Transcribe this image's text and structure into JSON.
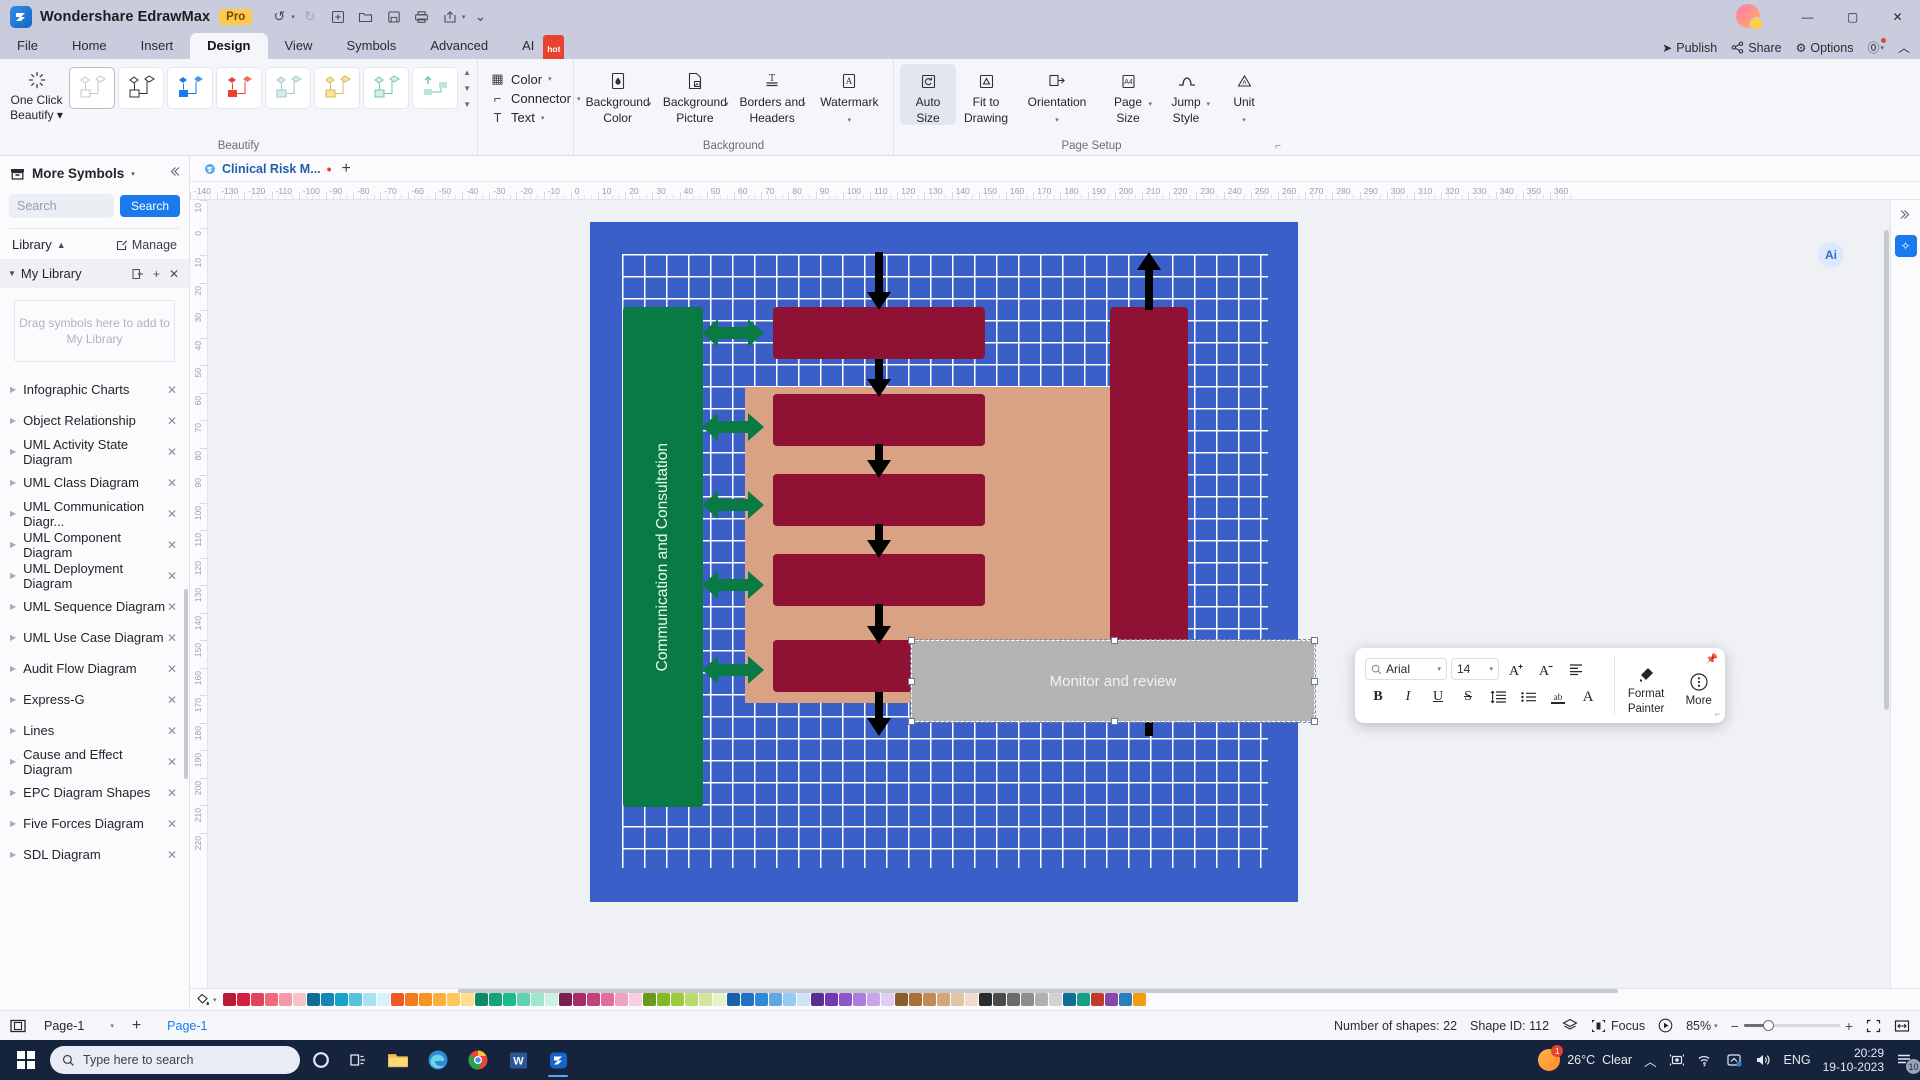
{
  "titlebar": {
    "app_name": "Wondershare EdrawMax",
    "pro_badge": "Pro",
    "logo_icon": "edraw-logo-icon",
    "quick_access": [
      {
        "name": "undo-icon",
        "glyph": "↺",
        "dim": false,
        "caret": true
      },
      {
        "name": "redo-icon",
        "glyph": "↻",
        "dim": true,
        "caret": false
      },
      {
        "name": "new-icon",
        "glyph": "⊞",
        "dim": false,
        "caret": false
      },
      {
        "name": "open-icon",
        "glyph": "🗁",
        "dim": false,
        "caret": false
      },
      {
        "name": "save-icon",
        "glyph": "🖫",
        "dim": false,
        "caret": false
      },
      {
        "name": "print-icon",
        "glyph": "🖨",
        "dim": false,
        "caret": false
      },
      {
        "name": "export-icon",
        "glyph": "🡕",
        "dim": false,
        "caret": true
      },
      {
        "name": "customize-qat-icon",
        "glyph": "⌄",
        "dim": false,
        "caret": false
      }
    ],
    "window_controls": [
      {
        "name": "minimize-button",
        "glyph": "—"
      },
      {
        "name": "maximize-button",
        "glyph": "▢"
      },
      {
        "name": "close-button",
        "glyph": "✕"
      }
    ]
  },
  "menubar": {
    "items": [
      {
        "label": "File",
        "active": false
      },
      {
        "label": "Home",
        "active": false
      },
      {
        "label": "Insert",
        "active": false
      },
      {
        "label": "Design",
        "active": true
      },
      {
        "label": "View",
        "active": false
      },
      {
        "label": "Symbols",
        "active": false
      },
      {
        "label": "Advanced",
        "active": false
      },
      {
        "label": "AI",
        "active": false,
        "badge": "hot"
      }
    ],
    "right_items": [
      {
        "label": "Publish",
        "icon": "publish-icon",
        "glyph": "➤"
      },
      {
        "label": "Share",
        "icon": "share-icon",
        "glyph": "⦿"
      },
      {
        "label": "Options",
        "icon": "gear-icon",
        "glyph": "⚙"
      },
      {
        "label": "",
        "icon": "help-icon",
        "glyph": "?"
      },
      {
        "label": "",
        "icon": "collapse-ribbon-icon",
        "glyph": "︿"
      }
    ]
  },
  "ribbon": {
    "groups": [
      {
        "label": "Beautify",
        "one_click": {
          "line1": "One Click",
          "line2": "Beautify",
          "icon": "sparkle-icon"
        },
        "gallery_count": 8
      },
      {
        "label": "",
        "stack": [
          {
            "label": "Color",
            "icon": "color-grid-icon",
            "glyph": "▦",
            "caret": true
          },
          {
            "label": "Connector",
            "icon": "connector-icon",
            "glyph": "⌐",
            "caret": true
          },
          {
            "label": "Text",
            "icon": "text-icon",
            "glyph": "T",
            "caret": true
          }
        ]
      },
      {
        "label": "Background",
        "buttons": [
          {
            "line1": "Background",
            "line2": "Color",
            "icon": "background-color-icon",
            "caret": true,
            "active": false
          },
          {
            "line1": "Background",
            "line2": "Picture",
            "icon": "background-picture-icon",
            "caret": true,
            "active": false
          },
          {
            "line1": "Borders and",
            "line2": "Headers",
            "icon": "borders-headers-icon",
            "caret": true,
            "active": false
          },
          {
            "line1": "Watermark",
            "line2": "",
            "icon": "watermark-icon",
            "caret": true,
            "active": false
          }
        ]
      },
      {
        "label": "Page Setup",
        "buttons": [
          {
            "line1": "Auto",
            "line2": "Size",
            "icon": "auto-size-icon",
            "caret": false,
            "active": true
          },
          {
            "line1": "Fit to",
            "line2": "Drawing",
            "icon": "fit-to-drawing-icon",
            "caret": false,
            "active": false
          },
          {
            "line1": "Orientation",
            "line2": "",
            "icon": "orientation-icon",
            "caret": true,
            "active": false
          },
          {
            "line1": "Page",
            "line2": "Size",
            "icon": "page-size-icon",
            "caret": true,
            "active": false
          },
          {
            "line1": "Jump",
            "line2": "Style",
            "icon": "jump-style-icon",
            "caret": true,
            "active": false
          },
          {
            "line1": "Unit",
            "line2": "",
            "icon": "unit-icon",
            "caret": true,
            "active": false
          }
        ]
      }
    ]
  },
  "left_panel": {
    "header": {
      "label": "More Symbols",
      "icon": "symbols-box-icon"
    },
    "search": {
      "placeholder": "Search",
      "button_label": "Search"
    },
    "library_row": {
      "label": "Library",
      "manage_label": "Manage",
      "collapse_icon": "chevron-up-icon",
      "manage_icon": "edit-icon"
    },
    "my_library": {
      "label": "My Library",
      "dropzone": "Drag symbols here to add to My Library"
    },
    "items": [
      {
        "label": "Infographic Charts"
      },
      {
        "label": "Object Relationship"
      },
      {
        "label": "UML Activity State Diagram"
      },
      {
        "label": "UML Class Diagram"
      },
      {
        "label": "UML Communication Diagr..."
      },
      {
        "label": "UML Component Diagram"
      },
      {
        "label": "UML Deployment Diagram"
      },
      {
        "label": "UML Sequence Diagram"
      },
      {
        "label": "UML Use Case Diagram"
      },
      {
        "label": "Audit Flow Diagram"
      },
      {
        "label": "Express-G"
      },
      {
        "label": "Lines"
      },
      {
        "label": "Cause and Effect Diagram"
      },
      {
        "label": "EPC Diagram Shapes"
      },
      {
        "label": "Five Forces Diagram"
      },
      {
        "label": "SDL Diagram"
      }
    ]
  },
  "document": {
    "tab_title": "Clinical Risk M...",
    "tab_modified": true,
    "add_tab_label": "+"
  },
  "rulers": {
    "horizontal": [
      "-140",
      "-130",
      "-120",
      "-110",
      "-100",
      "-90",
      "-80",
      "-70",
      "-60",
      "-50",
      "-40",
      "-30",
      "-20",
      "-10",
      "0",
      "10",
      "20",
      "30",
      "40",
      "50",
      "60",
      "70",
      "80",
      "90",
      "100",
      "110",
      "120",
      "130",
      "140",
      "150",
      "160",
      "170",
      "180",
      "190",
      "200",
      "210",
      "220",
      "230",
      "240",
      "250",
      "260",
      "270",
      "280",
      "290",
      "300",
      "310",
      "320",
      "330",
      "340",
      "350",
      "360"
    ],
    "vertical": [
      "10",
      "0",
      "10",
      "20",
      "30",
      "40",
      "50",
      "60",
      "70",
      "80",
      "90",
      "100",
      "110",
      "120",
      "130",
      "140",
      "150",
      "160",
      "170",
      "180",
      "190",
      "200",
      "210",
      "220"
    ]
  },
  "diagram": {
    "green_bar_label": "Communication and Consultation",
    "selected_shape": {
      "label": "Monitor and review"
    }
  },
  "format_toolbar": {
    "font": {
      "value": "Arial",
      "icon": "search-icon"
    },
    "size": {
      "value": "14"
    },
    "row1": [
      {
        "name": "increase-font-size-icon",
        "glyph": "A⁺"
      },
      {
        "name": "decrease-font-size-icon",
        "glyph": "A⁻"
      },
      {
        "name": "align-icon",
        "glyph": "≡"
      }
    ],
    "row2": [
      {
        "name": "bold-icon",
        "glyph": "B"
      },
      {
        "name": "italic-icon",
        "glyph": "I"
      },
      {
        "name": "underline-icon",
        "glyph": "U"
      },
      {
        "name": "strikethrough-icon",
        "glyph": "S"
      },
      {
        "name": "line-spacing-icon",
        "glyph": "↕≡"
      },
      {
        "name": "bullet-list-icon",
        "glyph": "☰"
      },
      {
        "name": "text-highlight-icon",
        "glyph": "ab"
      },
      {
        "name": "font-color-icon",
        "glyph": "A"
      }
    ],
    "format_painter": {
      "line1": "Format",
      "line2": "Painter",
      "icon": "format-painter-icon"
    },
    "more": {
      "label": "More",
      "icon": "more-options-icon"
    },
    "pin_icon": "pin-icon"
  },
  "right_rail": {
    "items": [
      {
        "name": "expand-panel-icon",
        "glyph": "❮"
      },
      {
        "name": "ai-assistant-icon",
        "glyph": "✧"
      }
    ],
    "ai_float": {
      "name": "ai-badge-icon",
      "glyph": "Ai"
    }
  },
  "color_strip": {
    "fill_icon": "fill-color-icon",
    "swatches": [
      "#b81c32",
      "#d6203f",
      "#e2455b",
      "#ef6a7c",
      "#f59aa8",
      "#f7c3cb",
      "#0f6e96",
      "#1488b5",
      "#19a3c9",
      "#55c3dd",
      "#a8e2ee",
      "#d9f2f8",
      "#ee5a24",
      "#f47b20",
      "#f79320",
      "#fbb03b",
      "#fdc75a",
      "#fedd8d",
      "#0d8a62",
      "#13a575",
      "#1abc8a",
      "#5fd3ae",
      "#9fe6cc",
      "#cdf2e4",
      "#7b1f4f",
      "#a52c67",
      "#c4417f",
      "#de6ea0",
      "#efa3c3",
      "#f7cfdf",
      "#6a9a1c",
      "#86b824",
      "#9ecb3a",
      "#b8da6b",
      "#d1e79c",
      "#e6f2c8",
      "#1a5faa",
      "#2272c4",
      "#2f8ad6",
      "#5ea9e4",
      "#97caef",
      "#cde4f8",
      "#5c2d91",
      "#7439b0",
      "#8f55c9",
      "#ac7ddb",
      "#c9a5e9",
      "#e2cdf5",
      "#8a5b2b",
      "#a8713a",
      "#c08a52",
      "#d3a67b",
      "#e3c3a5",
      "#f0dcca",
      "#2b2b2b",
      "#4a4a4a",
      "#6b6b6b",
      "#8d8d8d",
      "#b0b0b0",
      "#d2d2d2",
      "#0f6e96",
      "#16a085",
      "#c0392b",
      "#8e44ad",
      "#2980b9",
      "#f39c12"
    ]
  },
  "status_bar": {
    "page_selector": "Page-1",
    "add_page_label": "+",
    "page_tab": "Page-1",
    "shape_count": "Number of shapes: 22",
    "shape_id": "Shape ID: 112",
    "focus_label": "Focus",
    "zoom_level": "85%",
    "layers_icon": "layers-icon",
    "focus_icon": "focus-icon",
    "play_icon": "presentation-icon",
    "fullscreen_icon": "fullscreen-icon",
    "fitwidth_icon": "fit-width-icon",
    "switch_view_icon": "switch-view-icon"
  },
  "taskbar": {
    "search_placeholder": "Type here to search",
    "weather": {
      "temp": "26°C",
      "condition": "Clear"
    },
    "language": "ENG",
    "time": "20:29",
    "date": "19-10-2023",
    "notification_count": "10",
    "apps": [
      {
        "name": "task-view-icon",
        "glyph": "❑"
      },
      {
        "name": "file-explorer-icon",
        "glyph": "🗀"
      },
      {
        "name": "edge-icon",
        "glyph": "◓"
      },
      {
        "name": "chrome-icon",
        "glyph": "◉"
      },
      {
        "name": "word-icon",
        "glyph": "W"
      },
      {
        "name": "edrawmax-icon",
        "glyph": "E"
      }
    ],
    "tray": [
      {
        "name": "show-hidden-icons",
        "glyph": "︿"
      },
      {
        "name": "camera-icon",
        "glyph": "▣"
      },
      {
        "name": "wifi-icon",
        "glyph": "◟"
      },
      {
        "name": "onedrive-icon",
        "glyph": "☁"
      },
      {
        "name": "volume-icon",
        "glyph": "🔊"
      }
    ]
  }
}
